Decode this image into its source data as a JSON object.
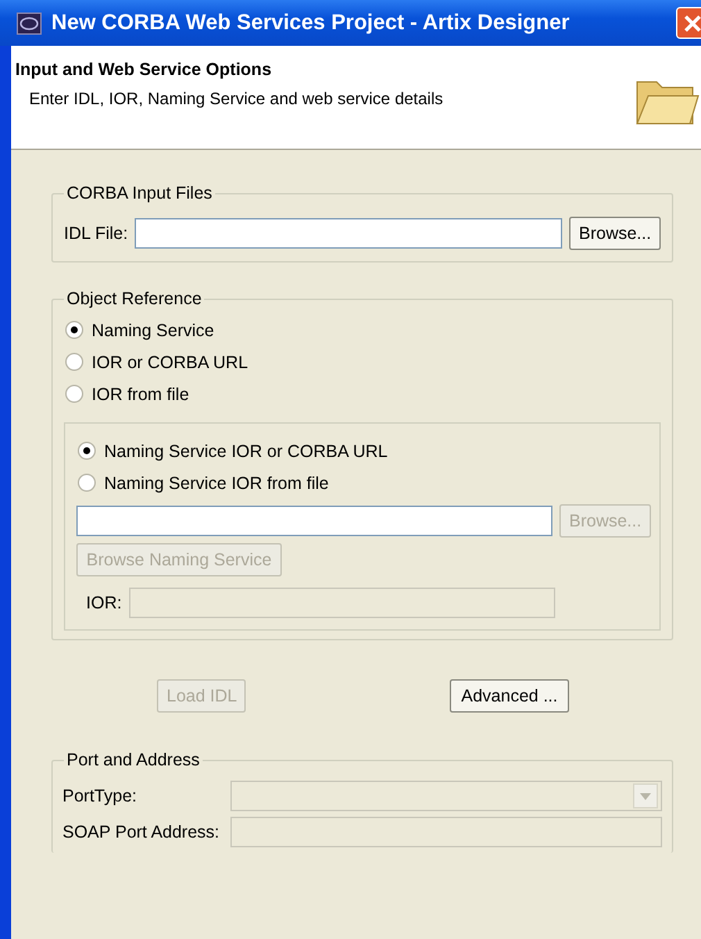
{
  "window": {
    "title": "New CORBA Web Services Project - Artix Designer"
  },
  "header": {
    "title": "Input and Web Service Options",
    "description": "Enter IDL, IOR, Naming Service and web service details"
  },
  "corba_input_files": {
    "title": "CORBA Input Files",
    "idl_file": {
      "label": "IDL File:",
      "disabled": false
    },
    "browse_button": {
      "label": "Browse...",
      "disabled": false
    }
  },
  "object_reference": {
    "title": "Object Reference",
    "options": [
      {
        "label": "Naming Service",
        "selected": true
      },
      {
        "label": "IOR or CORBA URL",
        "selected": false
      },
      {
        "label": "IOR from file",
        "selected": false
      }
    ],
    "naming_service": {
      "options": [
        {
          "label": "Naming Service IOR or CORBA URL",
          "selected": true
        },
        {
          "label": "Naming Service IOR from file",
          "selected": false
        }
      ],
      "input": {
        "disabled": false
      },
      "browse_button": {
        "label": "Browse...",
        "disabled": true
      },
      "browse_naming_service_button": {
        "label": "Browse Naming Service",
        "disabled": true
      },
      "ior": {
        "label": "IOR:",
        "disabled": true
      }
    }
  },
  "buttons": [
    {
      "label": "Load IDL",
      "disabled": true
    },
    {
      "label": "Advanced ...",
      "disabled": false
    }
  ],
  "port_and_address": {
    "title": "Port and Address",
    "fields": [
      {
        "kind": "combo",
        "label": "PortType:",
        "disabled": true
      },
      {
        "kind": "text",
        "label": "SOAP Port Address:",
        "disabled": true
      }
    ]
  }
}
